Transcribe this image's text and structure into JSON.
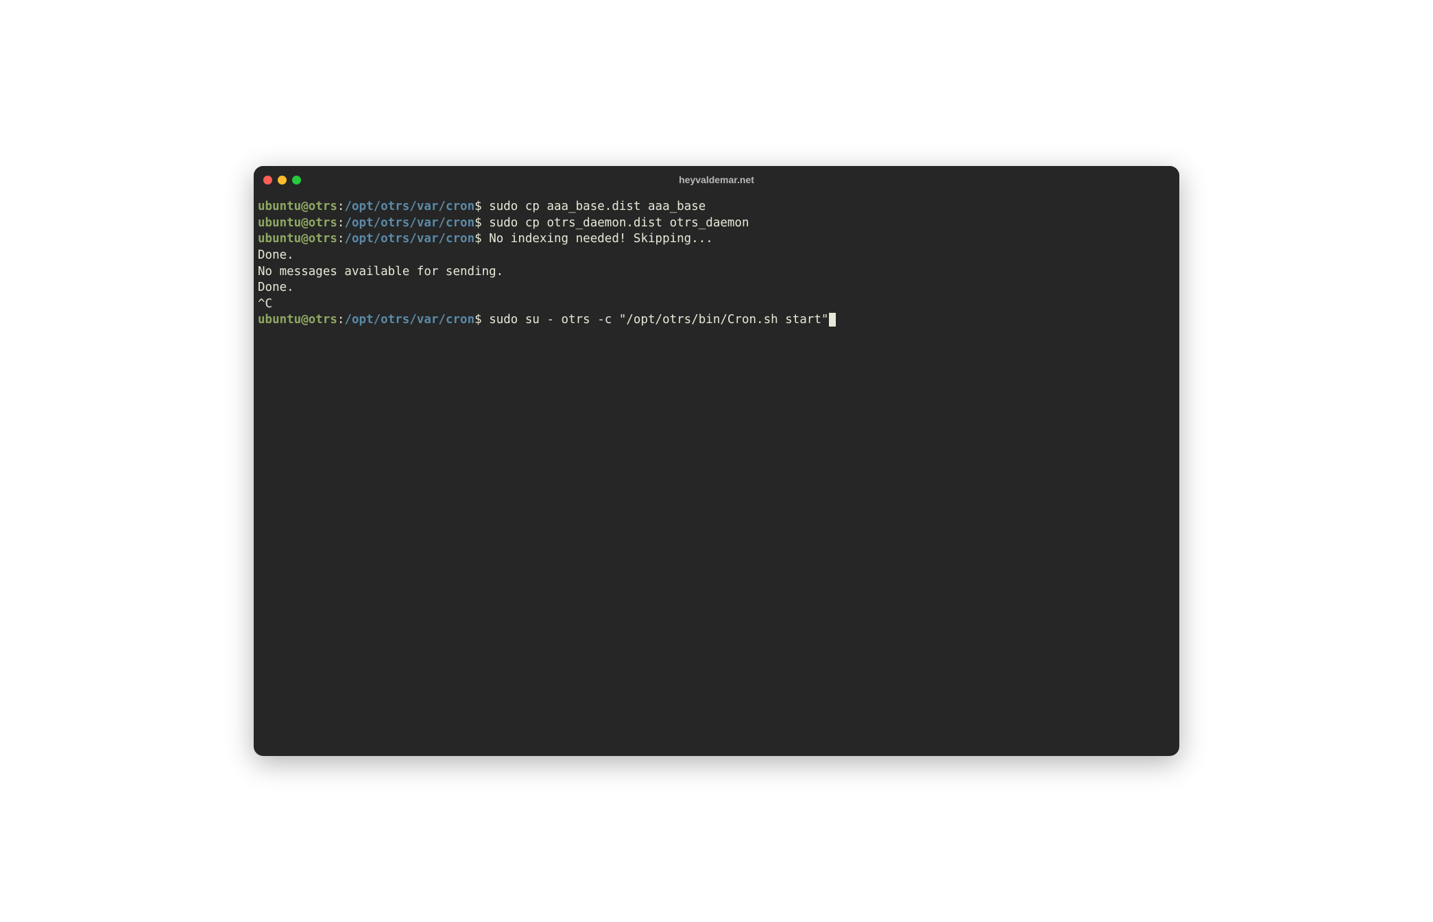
{
  "window": {
    "title": "heyvaldemar.net"
  },
  "prompt": {
    "user": "ubuntu",
    "at": "@",
    "host": "otrs",
    "colon": ":",
    "path": "/opt/otrs/var/cron",
    "symbol": "$ "
  },
  "lines": {
    "cmd1": "sudo cp aaa_base.dist aaa_base",
    "cmd2": "sudo cp otrs_daemon.dist otrs_daemon",
    "out1": "No indexing needed! Skipping...",
    "out2": "Done.",
    "out3": "",
    "out4": "No messages available for sending.",
    "out5": "Done.",
    "out6": "",
    "out7": "^C",
    "cmd3": "sudo su - otrs -c \"/opt/otrs/bin/Cron.sh start\""
  },
  "colors": {
    "bg": "#262626",
    "user": "#8fa862",
    "path": "#5a8aa8",
    "text": "#e8e8d8",
    "close": "#ff5f56",
    "minimize": "#ffbd2e",
    "maximize": "#27c93f"
  }
}
